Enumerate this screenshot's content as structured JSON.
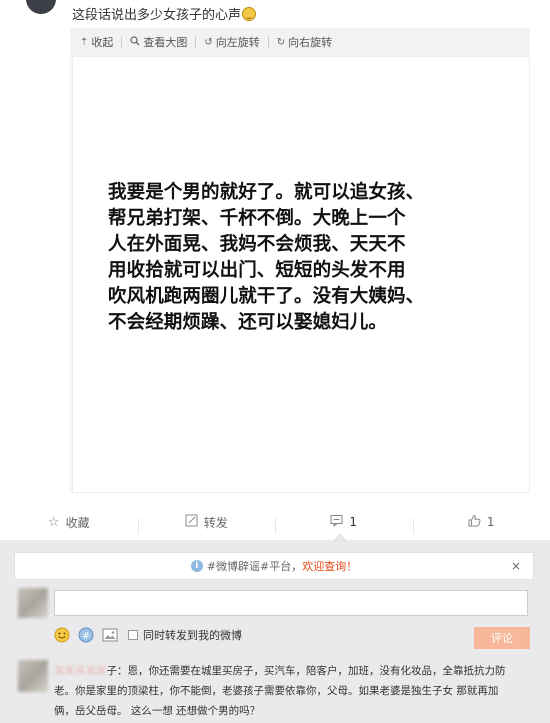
{
  "post": {
    "text": "这段话说出多少女孩子的心声",
    "emoji_icon": "grin-emoji-icon"
  },
  "image_toolbar": {
    "collapse": "收起",
    "view_large": "查看大图",
    "rotate_left": "向左旋转",
    "rotate_right": "向右旋转"
  },
  "image_text": {
    "lines": [
      "我要是个男的就好了。就可以追女孩、",
      "帮兄弟打架、千杯不倒。大晚上一个",
      "人在外面晃、我妈不会烦我、天天不",
      "用收拾就可以出门、短短的头发不用",
      "吹风机跑两圈儿就干了。没有大姨妈、",
      "不会经期烦躁、还可以娶媳妇儿。"
    ]
  },
  "actions": {
    "favorite": "收藏",
    "repost": "转发",
    "comment_count": "1",
    "like_count": "1"
  },
  "notice": {
    "prefix": "#微博辟谣#平台，",
    "link": "欢迎查询！",
    "close": "×"
  },
  "comment_form": {
    "also_repost_label": "同时转发到我的微博",
    "submit_label": "评论"
  },
  "comment": {
    "user": "某某某某某",
    "lines": [
      "子：恩，你还需要在城里买房子，买汽车，陪客户，加班，没有化妆品，全靠抵抗力防",
      "老。你是家里的顶梁柱，你不能倒，老婆孩子需要依靠你，父母。如果老婆是独生子女 那就再加",
      "俩，岳父岳母。 这么一想 还想做个男的吗？"
    ]
  },
  "colors": {
    "accent_orange": "#f8b79a",
    "link_red": "#e64a19",
    "page_bg": "#f2f2f5"
  }
}
